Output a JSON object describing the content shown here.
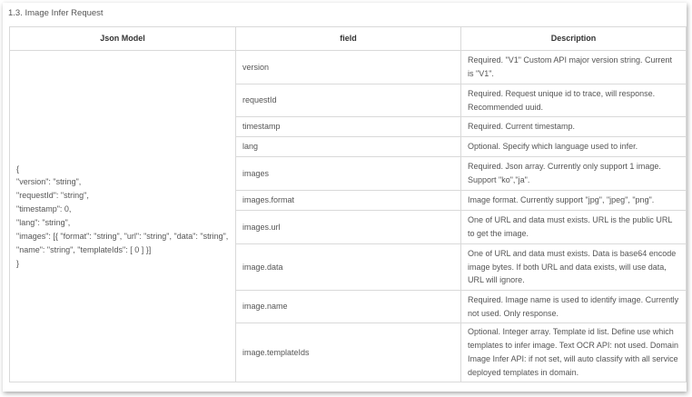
{
  "section": {
    "title": "1.3. Image Infer Request"
  },
  "table": {
    "headers": [
      "Json Model",
      "field",
      "Description"
    ],
    "json_model": "{\n\"version\": \"string\",\n\"requestId\": \"string\",\n\"timestamp\": 0,\n\"lang\": \"string\",\n\"images\": [{ \"format\": \"string\", \"url\": \"string\", \"data\": \"string\",\n\"name\": \"string\", \"templateIds\": [ 0 ] }]\n}",
    "rows": [
      {
        "field": "version",
        "description": "Required. \"V1\" Custom API major version string. Current is \"V1\"."
      },
      {
        "field": "requestId",
        "description": "Required. Request unique id to trace, will response. Recommended uuid."
      },
      {
        "field": "timestamp",
        "description": "Required. Current timestamp."
      },
      {
        "field": "lang",
        "description": "Optional. Specify which language used to infer."
      },
      {
        "field": "images",
        "description": "Required. Json array. Currently only support 1 image. Support \"ko\",\"ja\"."
      },
      {
        "field": "images.format",
        "description": "Image format. Currently support \"jpg\", \"jpeg\", \"png\"."
      },
      {
        "field": "images.url",
        "description": "One of URL and data must exists. URL is the public URL to get the image."
      },
      {
        "field": "image.data",
        "description": "One of URL and data must exists. Data is base64 encode image bytes. If both URL and data exists, will use data, URL will ignore."
      },
      {
        "field": "image.name",
        "description": "Required. Image name is used to identify image. Currently not used. Only response."
      },
      {
        "field": "image.templateIds",
        "description": "Optional. Integer array. Template id list. Define use which templates to infer image. Text OCR API: not used. Domain Image Infer API: if not set, will auto classify with all service deployed templates in domain."
      }
    ]
  }
}
